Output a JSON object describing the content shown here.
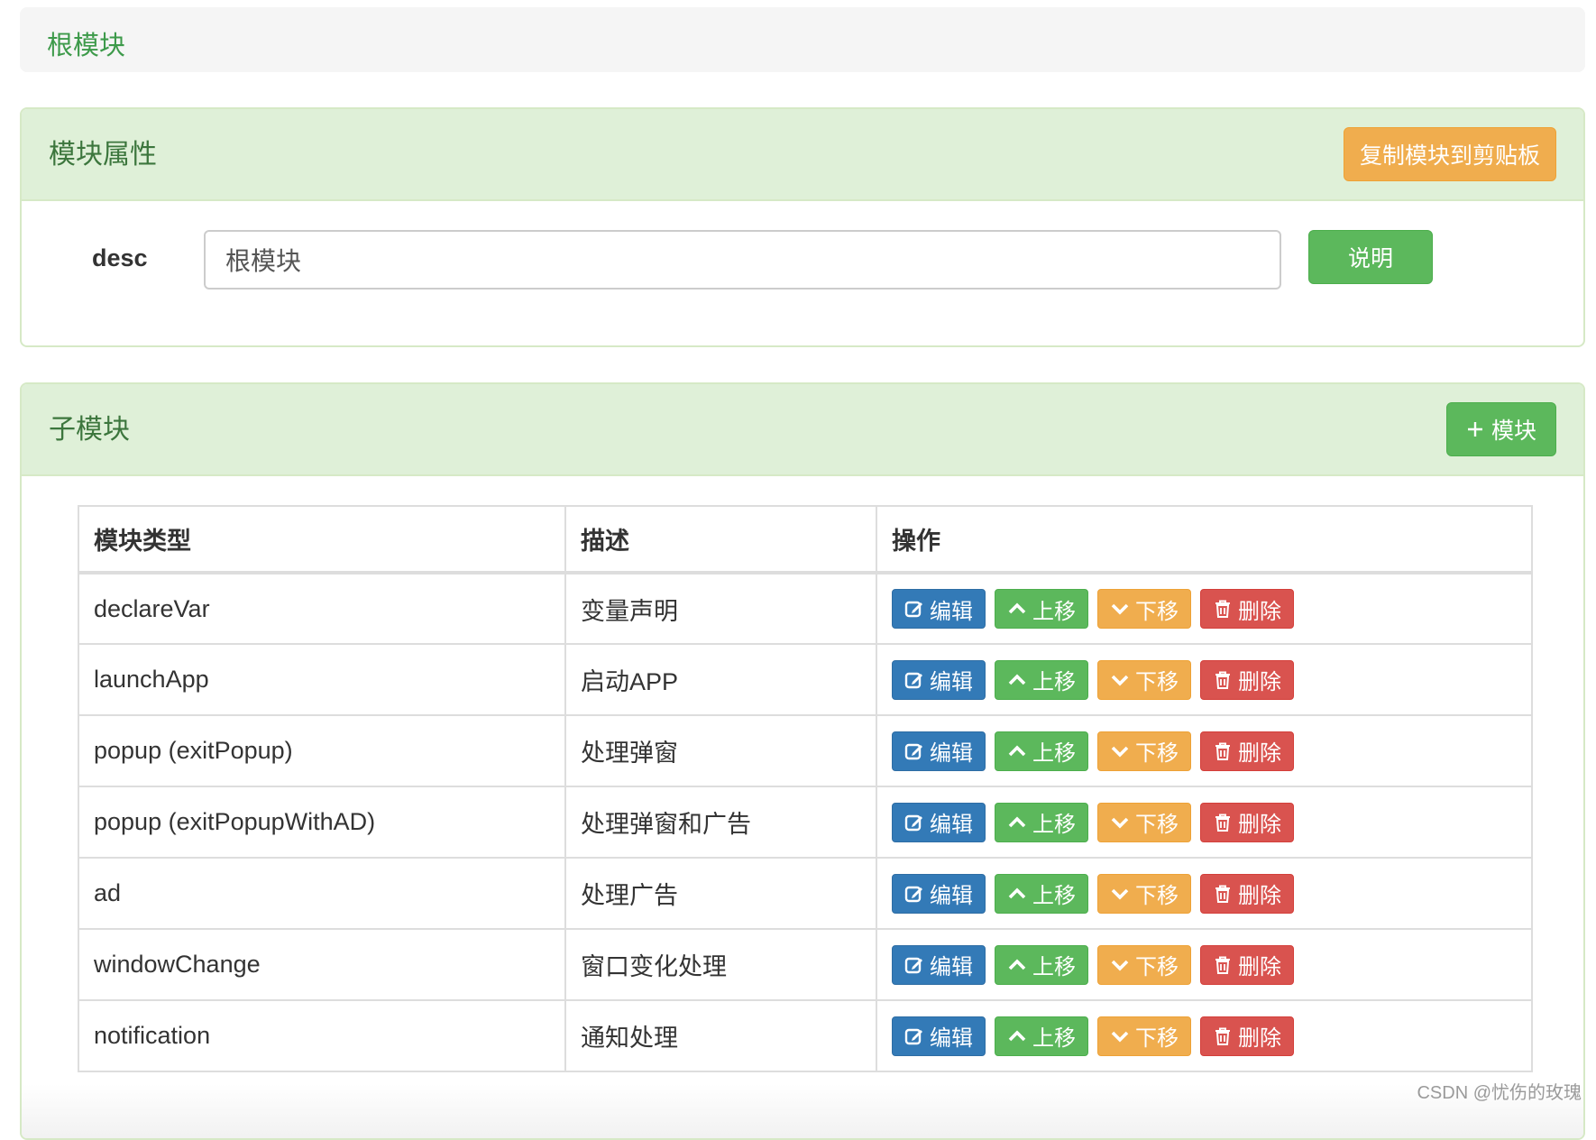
{
  "breadcrumb": {
    "root": "根模块"
  },
  "props_panel": {
    "title": "模块属性",
    "copy_button": "复制模块到剪贴板",
    "desc_label": "desc",
    "desc_value": "根模块",
    "explain_button": "说明"
  },
  "sub_panel": {
    "title": "子模块",
    "add_button": "模块",
    "add_icon": "plus-icon",
    "columns": [
      "模块类型",
      "描述",
      "操作"
    ],
    "rows": [
      {
        "type": "declareVar",
        "desc": "变量声明"
      },
      {
        "type": "launchApp",
        "desc": "启动APP"
      },
      {
        "type": "popup (exitPopup)",
        "desc": "处理弹窗"
      },
      {
        "type": "popup (exitPopupWithAD)",
        "desc": "处理弹窗和广告"
      },
      {
        "type": "ad",
        "desc": "处理广告"
      },
      {
        "type": "windowChange",
        "desc": "窗口变化处理"
      },
      {
        "type": "notification",
        "desc": "通知处理"
      }
    ],
    "actions": {
      "edit": "编辑",
      "up": "上移",
      "down": "下移",
      "delete": "删除"
    }
  },
  "watermark": "CSDN @忧伤的玫瑰",
  "colors": {
    "primary": "#337ab7",
    "success": "#5cb85c",
    "warning": "#f0ad4e",
    "danger": "#d9534f",
    "panel_heading": "#dff0d8"
  }
}
